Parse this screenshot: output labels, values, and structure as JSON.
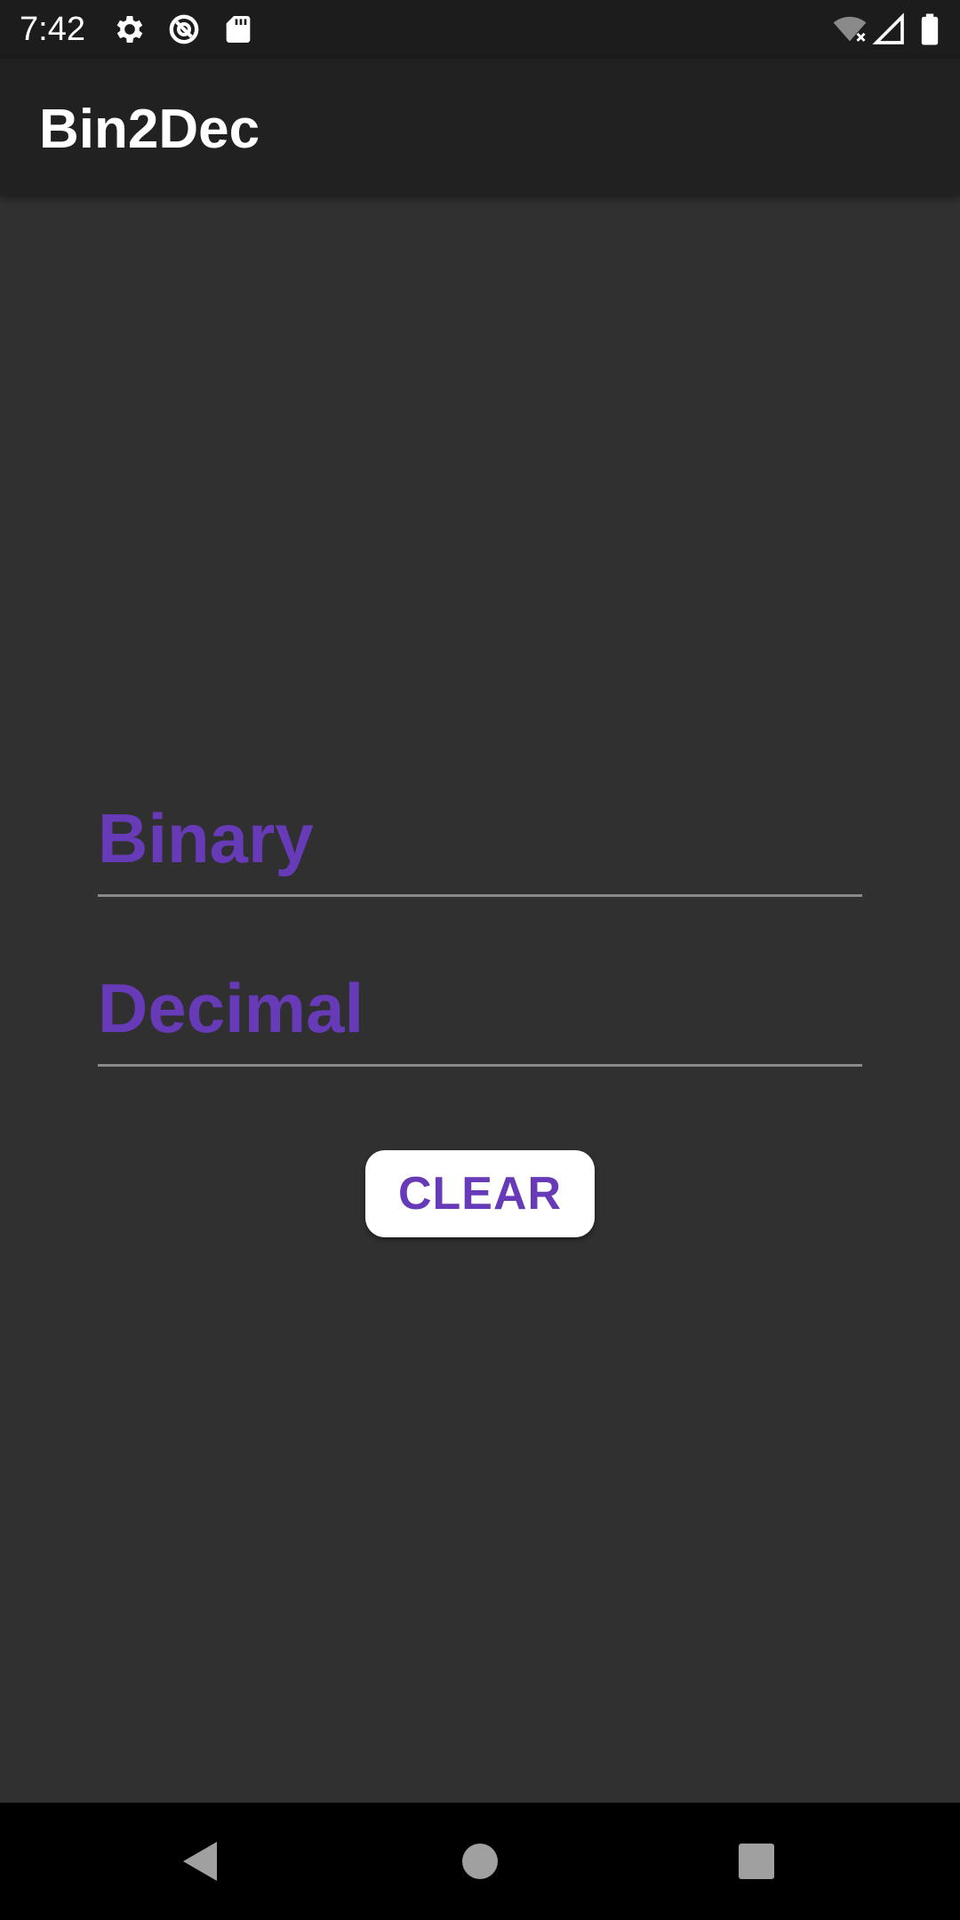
{
  "status_bar": {
    "time": "7:42",
    "icons_left": [
      "settings-icon",
      "data-saver-icon",
      "sd-card-icon"
    ],
    "icons_right": [
      "wifi-off-icon",
      "cell-signal-icon",
      "battery-icon"
    ]
  },
  "app_bar": {
    "title": "Bin2Dec"
  },
  "form": {
    "binary_placeholder": "Binary",
    "binary_value": "",
    "decimal_placeholder": "Decimal",
    "decimal_value": "",
    "clear_label": "CLEAR"
  },
  "nav_bar": {
    "buttons": [
      "back-icon",
      "home-icon",
      "recents-icon"
    ]
  },
  "colors": {
    "accent": "#673ab7",
    "background": "#303030",
    "app_bar": "#212121",
    "status_bar": "#1c1c1c"
  }
}
